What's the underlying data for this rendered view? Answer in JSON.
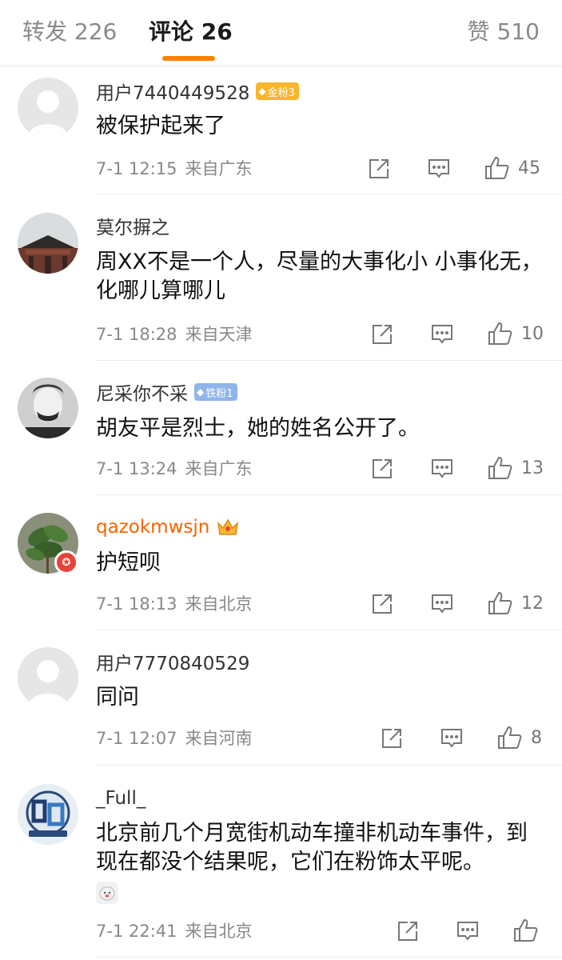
{
  "tabs": {
    "forward_label": "转发 226",
    "comment_label": "评论 26",
    "like_label": "赞 510"
  },
  "colors": {
    "accent": "#ff8200",
    "vip_name": "#f86300",
    "gold_badge": "#f9b52b",
    "iron_badge": "#8fb5ea",
    "verified_badge": "#e8433a"
  },
  "comments": [
    {
      "user": "用户7440449528",
      "badge": "金粉3",
      "avatar": "default-avatar-icon",
      "text": "被保护起来了",
      "date": "7-1 12:15",
      "location": "来自广东",
      "likes": "45"
    },
    {
      "user": "莫尔摒之",
      "avatar": "building-photo",
      "text": "周XX不是一个人，尽量的大事化小 小事化无，化哪儿算哪儿",
      "date": "7-1 18:28",
      "location": "来自天津",
      "likes": "10"
    },
    {
      "user": "尼采你不采",
      "badge": "铁粉1",
      "avatar": "portrait-photo",
      "text": "胡友平是烈士，她的姓名公开了。",
      "date": "7-1 13:24",
      "location": "来自广东",
      "likes": "13"
    },
    {
      "user": "qazokmwsjn",
      "avatar": "plant-photo",
      "text": "护短呗",
      "date": "7-1 18:13",
      "location": "来自北京",
      "likes": "12"
    },
    {
      "user": "用户7770840529",
      "avatar": "default-avatar-icon",
      "text": "同问",
      "date": "7-1 12:07",
      "location": "来自河南",
      "likes": "8"
    },
    {
      "user": "_Full_",
      "avatar": "emblem-logo",
      "text": "北京前几个月宽街机动车撞非机动车事件，到现在都没个结果呢，它们在粉饰太平呢。",
      "date": "7-1 22:41",
      "location": "来自北京",
      "likes": ""
    }
  ]
}
